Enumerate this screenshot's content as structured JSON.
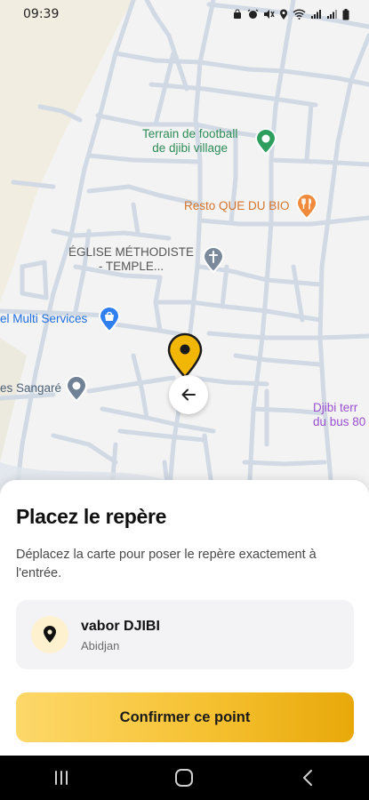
{
  "status_bar": {
    "time": "09:39"
  },
  "map": {
    "labels": {
      "football": {
        "line1": "Terrain de football",
        "line2": "de djibi village",
        "color": "#2e8b57"
      },
      "resto": {
        "text": "Resto QUE DU BIO",
        "color": "#d4742c"
      },
      "eglise": {
        "line1": "ÉGLISE MÉTHODISTE",
        "line2": "- TEMPLE...",
        "color": "#555555"
      },
      "multi": {
        "text": "el Multi Services",
        "color": "#1f6fe0"
      },
      "sangare": {
        "text": "es Sangaré",
        "color": "#4a5f75"
      },
      "djibi_bus": {
        "line1": "Djibi terr",
        "line2": "du bus 80",
        "color": "#9a4fd1"
      }
    }
  },
  "sheet": {
    "title": "Placez le repère",
    "description": "Déplacez la carte pour poser le repère exactement à l'entrée.",
    "place": {
      "name": "vabor DJIBI",
      "city": "Abidjan",
      "icon": "location-pin-icon"
    },
    "confirm_label": "Confirmer ce point"
  },
  "colors": {
    "accent": "#f6c233",
    "pin": "#f2b705"
  }
}
